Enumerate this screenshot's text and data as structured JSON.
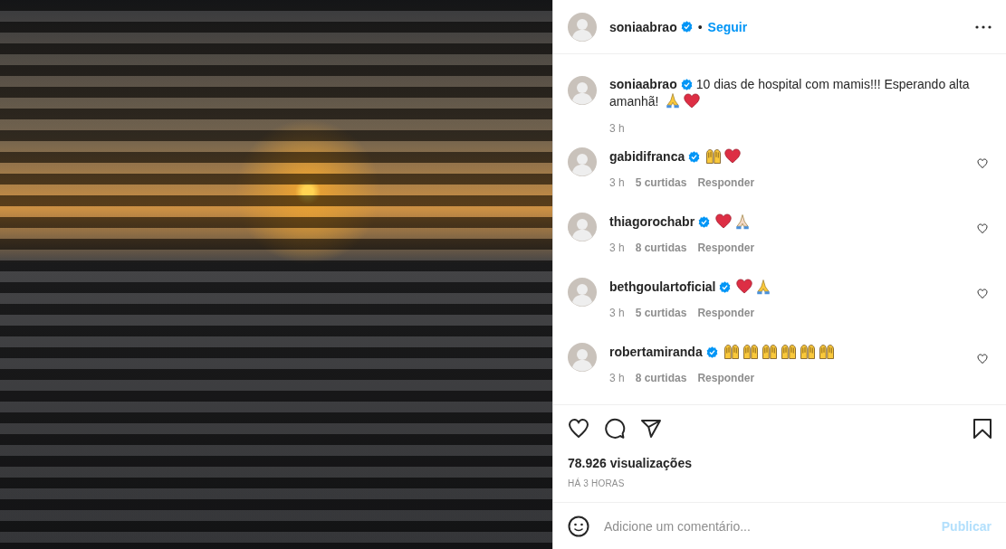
{
  "header": {
    "username": "soniaabrao",
    "verified": true,
    "separator": "•",
    "follow": "Seguir"
  },
  "caption": {
    "username": "soniaabrao",
    "verified": true,
    "text": "10 dias de hospital com mamis!!! Esperando alta amanhã!",
    "emojis": [
      {
        "kind": "pray"
      },
      {
        "kind": "heart"
      }
    ],
    "time": "3 h"
  },
  "comments": [
    {
      "username": "gabidifranca",
      "verified": true,
      "emojis": [
        {
          "kind": "raised_hands"
        },
        {
          "kind": "heart"
        }
      ],
      "time": "3 h",
      "likes": "5 curtidas",
      "reply": "Responder",
      "liked": false
    },
    {
      "username": "thiagorochabr",
      "verified": true,
      "emojis": [
        {
          "kind": "heart"
        },
        {
          "kind": "pray_light"
        }
      ],
      "time": "3 h",
      "likes": "8 curtidas",
      "reply": "Responder",
      "liked": false
    },
    {
      "username": "bethgoulartoficial",
      "verified": true,
      "emojis": [
        {
          "kind": "heart"
        },
        {
          "kind": "pray"
        }
      ],
      "time": "3 h",
      "likes": "5 curtidas",
      "reply": "Responder",
      "liked": false
    },
    {
      "username": "robertamiranda",
      "verified": true,
      "emojis": [
        {
          "kind": "raised_hands"
        },
        {
          "kind": "raised_hands"
        },
        {
          "kind": "raised_hands"
        },
        {
          "kind": "raised_hands"
        },
        {
          "kind": "raised_hands"
        },
        {
          "kind": "raised_hands"
        }
      ],
      "time": "3 h",
      "likes": "8 curtidas",
      "reply": "Responder",
      "liked": false
    }
  ],
  "views": "78.926 visualizações",
  "posted": "HÁ 3 HORAS",
  "comment_box": {
    "placeholder": "Adicione um comentário...",
    "submit": "Publicar",
    "submit_disabled": true
  }
}
